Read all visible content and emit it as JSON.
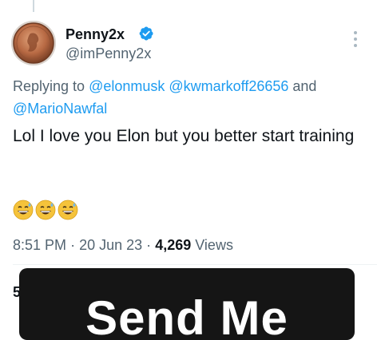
{
  "tweet": {
    "display_name": "Penny2x",
    "handle": "@imPenny2x",
    "reply_prefix": "Replying to ",
    "mentions": [
      "@elonmusk",
      "@kwmarkoff26656",
      "@MarioNawfal"
    ],
    "reply_joiner": " and",
    "text": "Lol I love you Elon but you better start training",
    "emoji_icons": [
      "grinning-sweat-face-icon",
      "grinning-sweat-face-icon",
      "grinning-sweat-face-icon"
    ],
    "time": "8:51 PM",
    "separator": "·",
    "date": "20 Jun 23",
    "views_count": "4,269",
    "views_label": "Views",
    "partial_stat": "5"
  },
  "overlay": {
    "text": "Send Me"
  },
  "colors": {
    "link": "#1d9bf0",
    "secondary_text": "#536471",
    "overlay_bg": "#151515",
    "verified": "#1d9bf0"
  }
}
